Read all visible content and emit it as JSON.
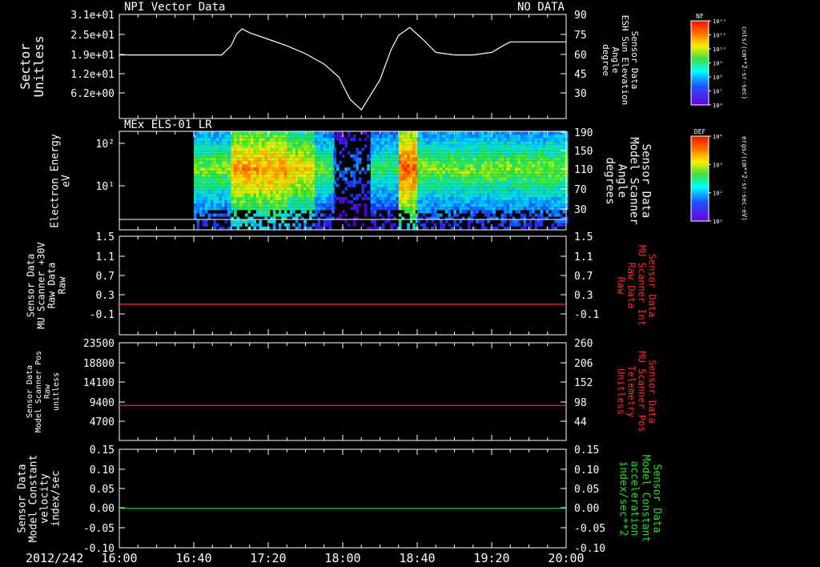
{
  "colors": {
    "white": "#ffffff",
    "red": "#ff2a2a",
    "green": "#20e020",
    "background": "#000000"
  },
  "chart_data": [
    {
      "type": "line",
      "title": "NPI Vector Data",
      "status_text": "NO DATA",
      "ylabel_left": [
        "Sector",
        "Unitless"
      ],
      "ylabel_right": [
        "Sensor Data",
        "ESH Sun Elevation",
        "Angle",
        "degree"
      ],
      "left_ticks": [
        "3.1e+01",
        "2.5e+01",
        "1.9e+01",
        "1.2e+01",
        "6.2e+00"
      ],
      "right_ticks": [
        "90",
        "75",
        "60",
        "45",
        "30"
      ],
      "ylim_right": [
        15,
        90
      ],
      "series": [
        {
          "color": "#ffffff",
          "x_minutes": [
            0,
            30,
            55,
            60,
            63,
            66,
            70,
            80,
            90,
            100,
            110,
            118,
            120,
            124,
            130,
            140,
            146,
            150,
            156,
            163,
            170,
            180,
            190,
            200,
            206,
            210,
            220,
            240
          ],
          "y": [
            59,
            59,
            59,
            66,
            75,
            79,
            76,
            71,
            66,
            60,
            52,
            42,
            36,
            25,
            17,
            40,
            63,
            74,
            80,
            71,
            61,
            59,
            59,
            61,
            66,
            69,
            69,
            69
          ]
        }
      ]
    },
    {
      "type": "heatmap",
      "title": "MEx ELS-01 LR",
      "ylabel_left": [
        "Electron Energy",
        "eV"
      ],
      "ylabel_right": [
        "Sensor Data",
        "Model Scanner",
        "Angle",
        "degrees"
      ],
      "left_ticks": [
        "10²",
        "10¹"
      ],
      "right_ticks": [
        "190",
        "150",
        "110",
        "70",
        "30"
      ],
      "overlay_line_color": "#ffffff",
      "colorbar_title": "DEF",
      "colorbar_unit": "ergs/(cm**2-sr-sec-eV)",
      "colorbar_ticks": [
        "10⁴",
        "10³",
        "10²",
        "10¹"
      ],
      "intensity_blocks": [
        {
          "t0": 40,
          "t1": 60,
          "level": 0.55
        },
        {
          "t0": 60,
          "t1": 90,
          "level": 0.85
        },
        {
          "t0": 90,
          "t1": 105,
          "level": 0.75
        },
        {
          "t0": 105,
          "t1": 115,
          "level": 0.5
        },
        {
          "t0": 115,
          "t1": 135,
          "level": 0.15
        },
        {
          "t0": 135,
          "t1": 150,
          "level": 0.45
        },
        {
          "t0": 150,
          "t1": 160,
          "level": 0.95
        },
        {
          "t0": 160,
          "t1": 240,
          "level": 0.55
        }
      ]
    },
    {
      "type": "line",
      "ylabel_left": [
        "Sensor Data",
        "MU Scanner +30V",
        "Raw Data",
        "Raw"
      ],
      "ylabel_right": [
        "Sensor Data",
        "MU Scanner Int",
        "Raw Data",
        "Raw"
      ],
      "left_ticks": [
        "1.5",
        "1.1",
        "0.7",
        "0.3",
        "-0.1"
      ],
      "right_ticks": [
        "1.5",
        "1.1",
        "0.7",
        "0.3",
        "-0.1"
      ],
      "ylim": [
        -0.3,
        1.5
      ],
      "series": [
        {
          "color": "#ff2a2a",
          "x_minutes": [
            0,
            240
          ],
          "y": [
            0.1,
            0.1
          ]
        }
      ]
    },
    {
      "type": "line",
      "ylabel_left": [
        "Sensor Data",
        "Model Scanner Pos",
        "Raw",
        "unitless"
      ],
      "ylabel_right": [
        "Sensor Data",
        "MU Scanner Pos",
        "Telemetry",
        "Unitless"
      ],
      "left_ticks": [
        "23500",
        "18800",
        "14100",
        "9400",
        "4700"
      ],
      "right_ticks": [
        "260",
        "206",
        "152",
        "98",
        "44"
      ],
      "ylim": [
        0,
        23500
      ],
      "series": [
        {
          "color": "#ff2a2a",
          "x_minutes": [
            0,
            240
          ],
          "y": [
            8500,
            8500
          ]
        }
      ]
    },
    {
      "type": "line",
      "ylabel_left": [
        "Sensor Data",
        "Model Constant",
        "velocity",
        "index/sec"
      ],
      "ylabel_right": [
        "Sensor Data",
        "Model Constant",
        "acceleration",
        "index/sec**2"
      ],
      "left_ticks": [
        "0.15",
        "0.10",
        "0.05",
        "0.00",
        "-0.05",
        "-0.10"
      ],
      "right_ticks": [
        "0.15",
        "0.10",
        "0.05",
        "0.00",
        "-0.05",
        "-0.10"
      ],
      "ylim": [
        -0.1,
        0.15
      ],
      "series": [
        {
          "color": "#20e020",
          "x_minutes": [
            0,
            240
          ],
          "y": [
            0.0,
            0.0
          ]
        }
      ]
    }
  ],
  "colorbar_top": {
    "title": "NF",
    "unit": "cnts/(cm**2-sr-sec)",
    "ticks": [
      "10¹²",
      "10¹¹",
      "10¹⁰",
      "10⁹",
      "10⁸",
      "10⁷",
      "10⁶"
    ]
  },
  "x_axis": {
    "date": "2012/242",
    "ticks": [
      "16:00",
      "16:40",
      "17:20",
      "18:00",
      "18:40",
      "19:20",
      "20:00"
    ]
  }
}
